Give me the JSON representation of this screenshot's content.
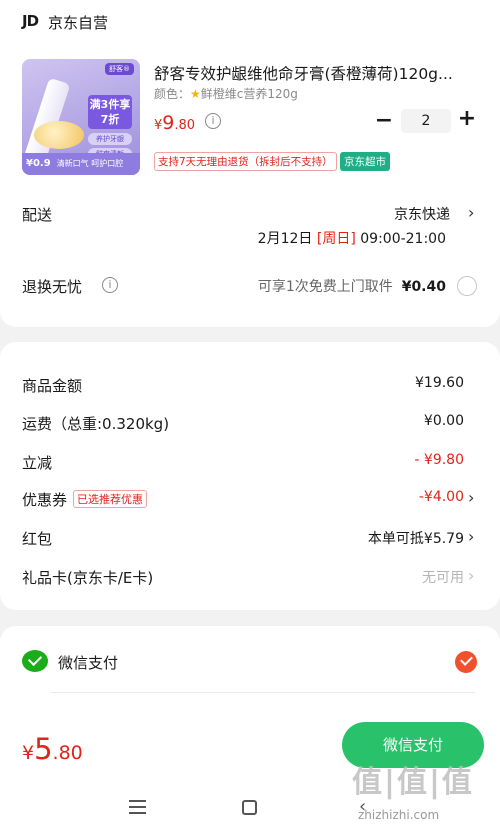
{
  "shop": {
    "logo_text": "JD",
    "name": "京东自营"
  },
  "product": {
    "title": "舒客专效护龈维他命牙膏(香橙薄荷)120g...",
    "spec_label": "颜色：",
    "spec_value": "鲜橙维c营养120g",
    "price_currency": "¥",
    "price_integer": "9",
    "price_decimal": ".80",
    "quantity": "2",
    "tag_return": "支持7天无理由退货（拆封后不支持）",
    "tag_supermarket": "京东超市",
    "image": {
      "brand": "舒客®",
      "promo": "满3件享7折",
      "chip_1": "养护牙龈",
      "chip_2": "鲜爽清新",
      "small_price": "¥0.9",
      "bottom_text": "清新口气 呵护口腔"
    }
  },
  "delivery": {
    "label": "配送",
    "method": "京东快递",
    "date": "2月12日",
    "weekday": "[周日]",
    "time_range": "09:00-21:00"
  },
  "return_service": {
    "label": "退换无忧",
    "desc": "可享1次免费上门取件",
    "price": "¥0.40"
  },
  "summary": {
    "goods_label": "商品金额",
    "goods_value": "¥19.60",
    "shipping_label": "运费（总重:0.320kg)",
    "shipping_value": "¥0.00",
    "discount_label": "立减",
    "discount_value": "- ¥9.80",
    "coupon_label": "优惠券",
    "coupon_badge": "已选推荐优惠",
    "coupon_value": "-¥4.00",
    "redpacket_label": "红包",
    "redpacket_value": "本单可抵¥5.79",
    "giftcard_label": "礼品卡(京东卡/E卡)",
    "giftcard_value": "无可用"
  },
  "payment": {
    "method_label": "微信支付",
    "total_currency": "¥",
    "total_integer": "5",
    "total_decimal": ".80",
    "pay_button": "微信支付"
  },
  "watermark": {
    "text": "值|值|值",
    "url": "zhizhizhi.com"
  },
  "icons": {
    "chevron": "›",
    "info": "i",
    "minus": "−",
    "plus": "+"
  },
  "colors": {
    "price_red": "#e2231a",
    "wechat_green": "#1aad19",
    "pay_button_green": "#29c26a",
    "supermarket_green": "#1fae86",
    "selected_orange": "#f0502e"
  }
}
